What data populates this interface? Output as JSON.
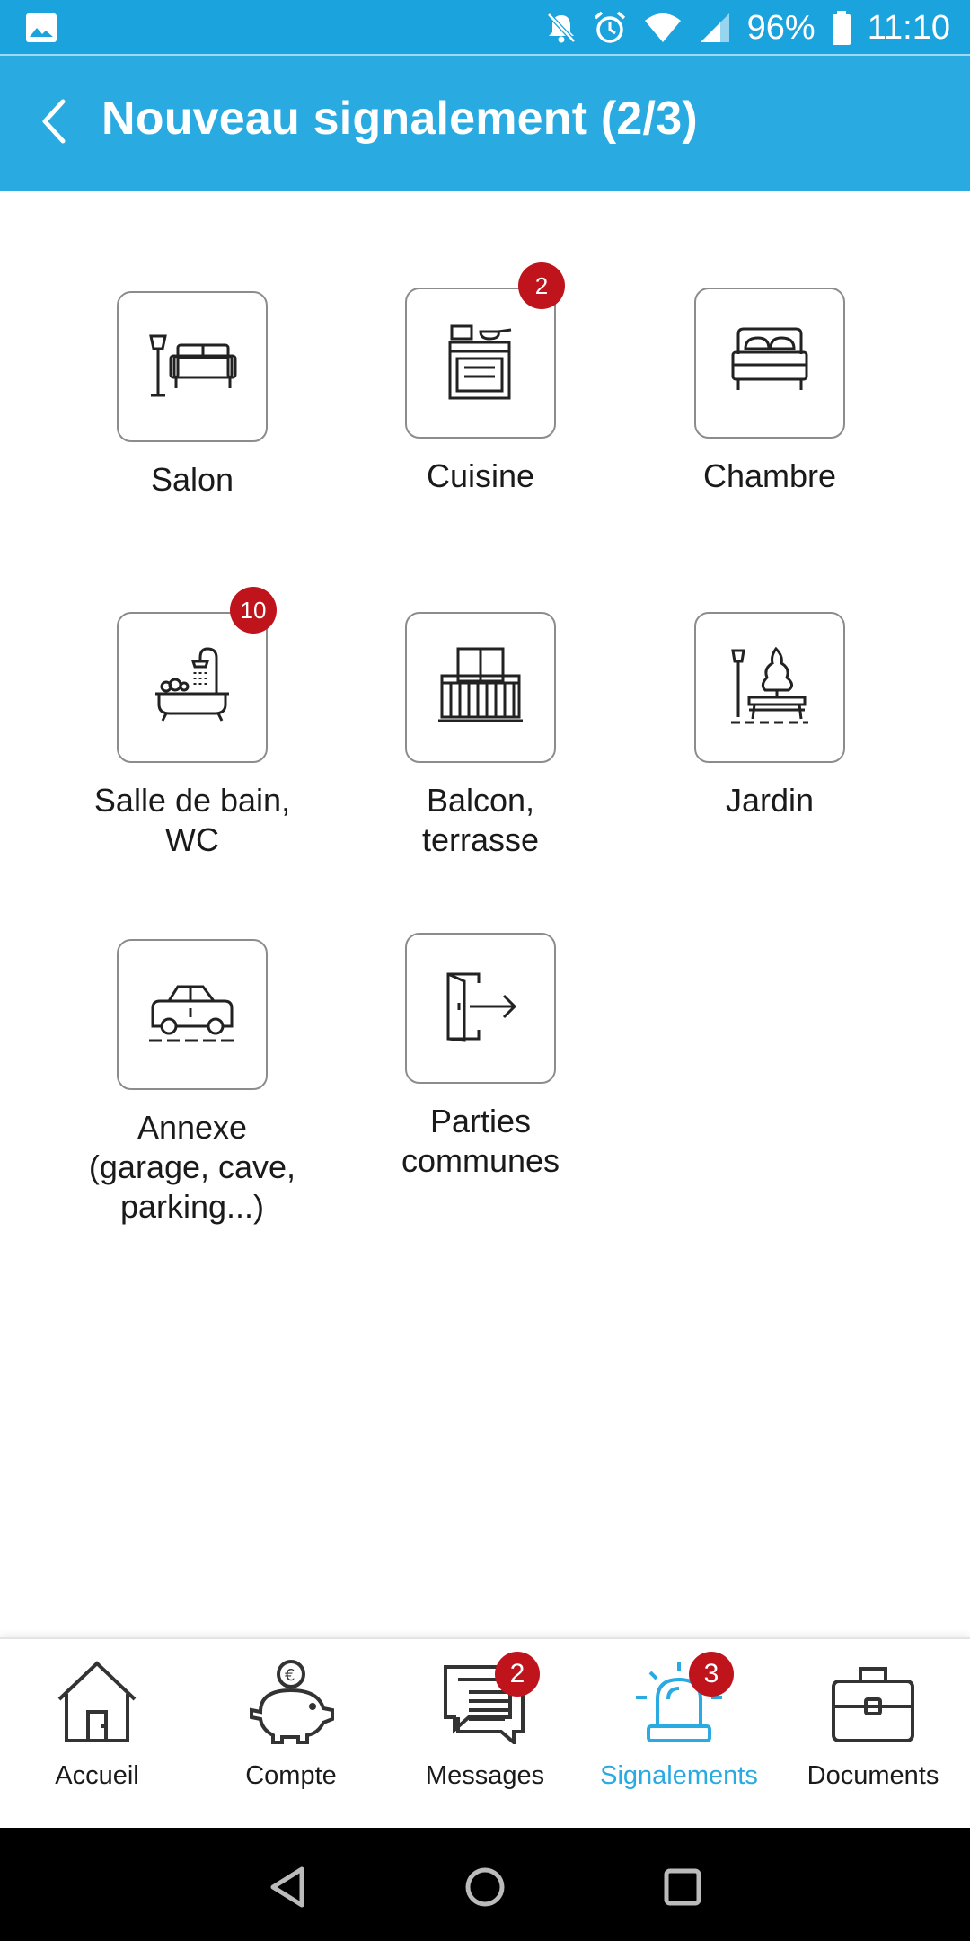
{
  "status_bar": {
    "battery_percent": "96%",
    "time": "11:10",
    "icons": [
      "image-icon",
      "bell-off-icon",
      "alarm-icon",
      "wifi-icon",
      "signal-icon",
      "battery-icon"
    ]
  },
  "app_bar": {
    "title": "Nouveau signalement (2/3)",
    "back_icon": "chevron-left-icon"
  },
  "categories": [
    {
      "label": "Salon",
      "icon": "sofa-icon",
      "badge": null
    },
    {
      "label": "Cuisine",
      "icon": "stove-icon",
      "badge": "2"
    },
    {
      "label": "Chambre",
      "icon": "bed-icon",
      "badge": null
    },
    {
      "label": "Salle de bain,\nWC",
      "icon": "bathtub-icon",
      "badge": "10"
    },
    {
      "label": "Balcon,\nterrasse",
      "icon": "balcony-icon",
      "badge": null
    },
    {
      "label": "Jardin",
      "icon": "garden-bench-icon",
      "badge": null
    },
    {
      "label": "Annexe\n(garage, cave,\nparking...)",
      "icon": "car-icon",
      "badge": null
    },
    {
      "label": "Parties\ncommunes",
      "icon": "exit-door-icon",
      "badge": null
    }
  ],
  "bottom_nav": [
    {
      "label": "Accueil",
      "icon": "home-icon",
      "badge": null,
      "active": false
    },
    {
      "label": "Compte",
      "icon": "piggy-bank-icon",
      "badge": null,
      "active": false
    },
    {
      "label": "Messages",
      "icon": "messages-icon",
      "badge": "2",
      "active": false
    },
    {
      "label": "Signalements",
      "icon": "siren-icon",
      "badge": "3",
      "active": true
    },
    {
      "label": "Documents",
      "icon": "briefcase-icon",
      "badge": null,
      "active": false
    }
  ],
  "system_nav": [
    "back-triangle-icon",
    "home-circle-icon",
    "recents-square-icon"
  ],
  "colors": {
    "primary": "#29abe2",
    "status_bar": "#1aa3dc",
    "badge": "#c0141c",
    "active_nav": "#29abe2"
  }
}
